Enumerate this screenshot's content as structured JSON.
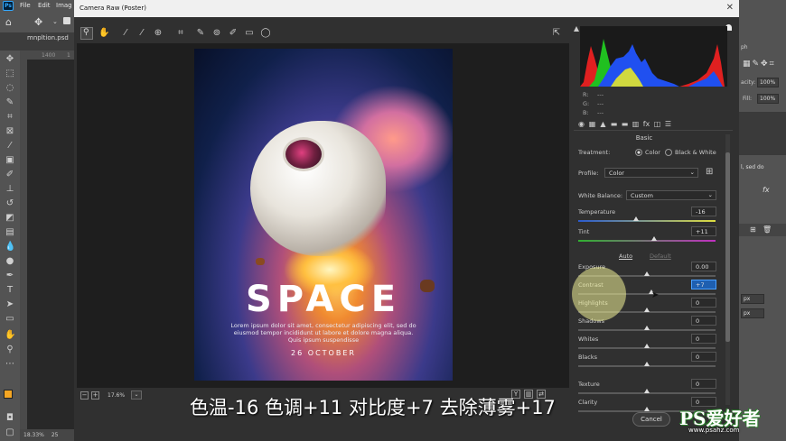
{
  "menubar": {
    "items": [
      "File",
      "Edit",
      "Imag"
    ]
  },
  "ps_document": {
    "tab_name": "mnpltion.psd",
    "ruler_value": "1400",
    "ruler_value2": "1",
    "zoom_status": "18.33%",
    "status_extra": "25"
  },
  "ps_right_panel": {
    "tab_label": "ph",
    "opacity_label": "acity:",
    "opacity_value": "100%",
    "fill_label": "Fill:",
    "fill_value": "100%",
    "text_fragment": "l, sed do",
    "fx_label": "fx",
    "px1": "px",
    "px2": "px"
  },
  "acr": {
    "window_title": "Camera Raw (Poster)",
    "close_label": "✕",
    "zoom_level": "17.6%",
    "poster": {
      "title": "SPACE",
      "body": "Lorem ipsum dolor sit amet, consectetur adipiscing elit, sed do eiusmod tempor incididunt ut labore et dolore magna aliqua. Quis ipsum suspendisse",
      "date": "26 OCTOBER"
    },
    "rgb": {
      "r_label": "R:",
      "r_value": "---",
      "g_label": "G:",
      "g_value": "---",
      "b_label": "B:",
      "b_value": "---"
    },
    "basic": {
      "header": "Basic",
      "treatment_label": "Treatment:",
      "treatment_color": "Color",
      "treatment_bw": "Black & White",
      "profile_label": "Profile:",
      "profile_value": "Color",
      "wb_label": "White Balance:",
      "wb_value": "Custom",
      "auto_label": "Auto",
      "default_label": "Default"
    },
    "sliders": [
      {
        "name": "Temperature",
        "value": "-16",
        "fraction": 0.42
      },
      {
        "name": "Tint",
        "value": "+11",
        "fraction": 0.55
      },
      {
        "name": "Exposure",
        "value": "0.00",
        "fraction": 0.5
      },
      {
        "name": "Contrast",
        "value": "+7",
        "fraction": 0.53
      },
      {
        "name": "Highlights",
        "value": "0",
        "fraction": 0.5
      },
      {
        "name": "Shadows",
        "value": "0",
        "fraction": 0.5
      },
      {
        "name": "Whites",
        "value": "0",
        "fraction": 0.5
      },
      {
        "name": "Blacks",
        "value": "0",
        "fraction": 0.5
      },
      {
        "name": "Texture",
        "value": "0",
        "fraction": 0.5
      },
      {
        "name": "Clarity",
        "value": "0",
        "fraction": 0.5
      }
    ],
    "cancel_label": "Cancel"
  },
  "subtitle": "色温-16  色调+11  对比度+7  去除薄雾+17",
  "watermark": {
    "big": "PS爱好者",
    "url": "www.psahz.com"
  },
  "colors": {
    "accent": "#31a8ff",
    "foreground_swatch": "#f5a623",
    "contrast_field": "#1e5fb0"
  }
}
